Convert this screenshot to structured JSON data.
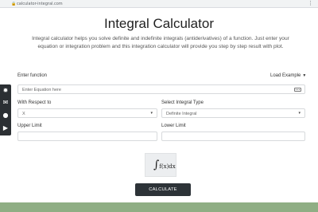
{
  "browser": {
    "url": "calculator-integral.com",
    "menu": "⋮"
  },
  "page": {
    "title": "Integral Calculator",
    "intro": "Integral calculator helps you solve definite and indefinite integrals (antiderivatives) of a function. Just enter your equation or integration problem and this integration calculator will provide you step by step result with plot."
  },
  "form": {
    "enter_function_label": "Enter function",
    "load_example": "Load Example",
    "equation_placeholder": "Enter Equation here",
    "respect_label": "With Respect to",
    "respect_value": "X",
    "integral_type_label": "Select Integral Type",
    "integral_type_value": "Definite Integral",
    "upper_limit_label": "Upper Limit",
    "lower_limit_label": "Lower Limit",
    "calculate_label": "CALCULATE"
  },
  "sidebar": {
    "icons": [
      "bug-icon",
      "chat-icon",
      "apple-icon",
      "play-store-icon"
    ]
  },
  "preview": {
    "symbol": "∫",
    "text": "f(x)dx"
  }
}
